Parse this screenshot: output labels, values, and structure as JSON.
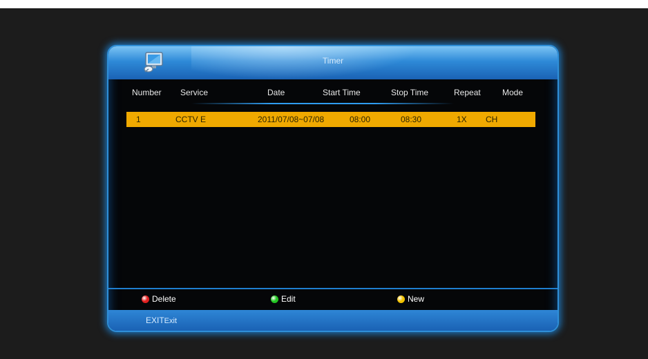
{
  "window": {
    "title": "Timer"
  },
  "columns": [
    "Number",
    "Service",
    "Date",
    "Start Time",
    "Stop Time",
    "Repeat",
    "Mode"
  ],
  "timers": [
    {
      "number": "1",
      "service": "CCTV E",
      "date": "2011/07/08~07/08",
      "start_time": "08:00",
      "stop_time": "08:30",
      "repeat": "1X",
      "mode": "CH"
    }
  ],
  "footer": {
    "delete": {
      "label": "Delete",
      "color": "#e02020"
    },
    "edit": {
      "label": "Edit",
      "color": "#22c422"
    },
    "new": {
      "label": "New",
      "color": "#f2c200"
    }
  },
  "bottom_bar": {
    "exit_key": "EXIT",
    "exit_label": "Exit"
  },
  "colors": {
    "accent": "#2f8fd8",
    "highlight_row": "#f0a900",
    "background": "#1c1c1c"
  },
  "icons": {
    "app": "monitor-satellite-icon"
  }
}
